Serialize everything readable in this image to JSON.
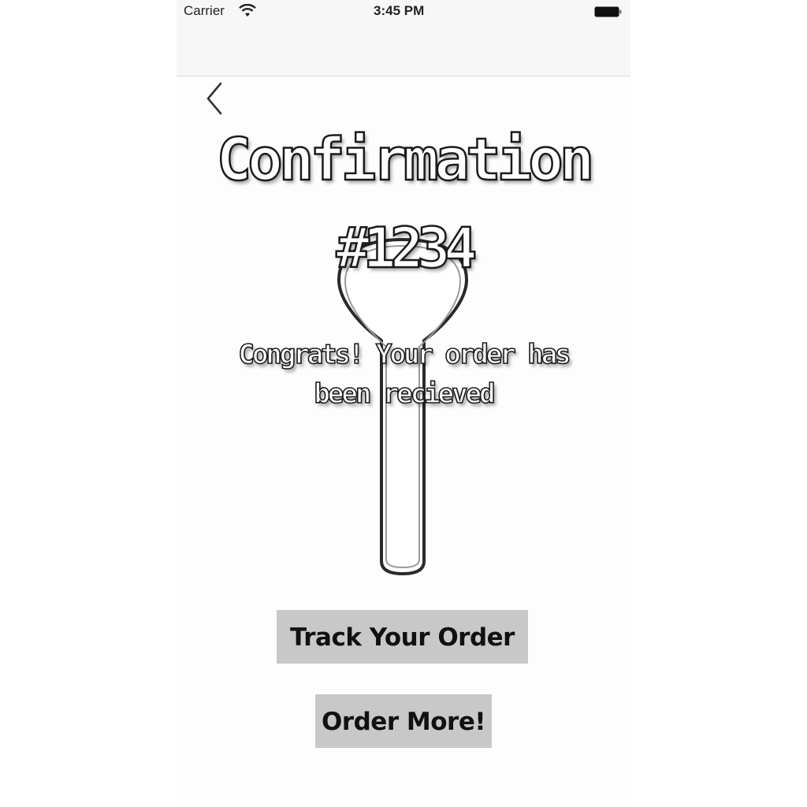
{
  "status_bar": {
    "carrier": "Carrier",
    "time": "3:45 PM",
    "wifi_icon": "wifi-icon",
    "battery_icon": "battery-icon"
  },
  "nav": {
    "back_icon": "chevron-left-icon"
  },
  "confirmation": {
    "title": "Confirmation",
    "order_number": "#1234",
    "message": "Congrats! Your order has been recieved"
  },
  "background_graphic": "spoon-outline",
  "actions": {
    "track_order_label": "Track Your Order",
    "order_more_label": "Order More!"
  },
  "colors": {
    "button_background": "#c8c8c8",
    "text_outline": "#1a1a1a",
    "text_fill": "#ffffff"
  }
}
